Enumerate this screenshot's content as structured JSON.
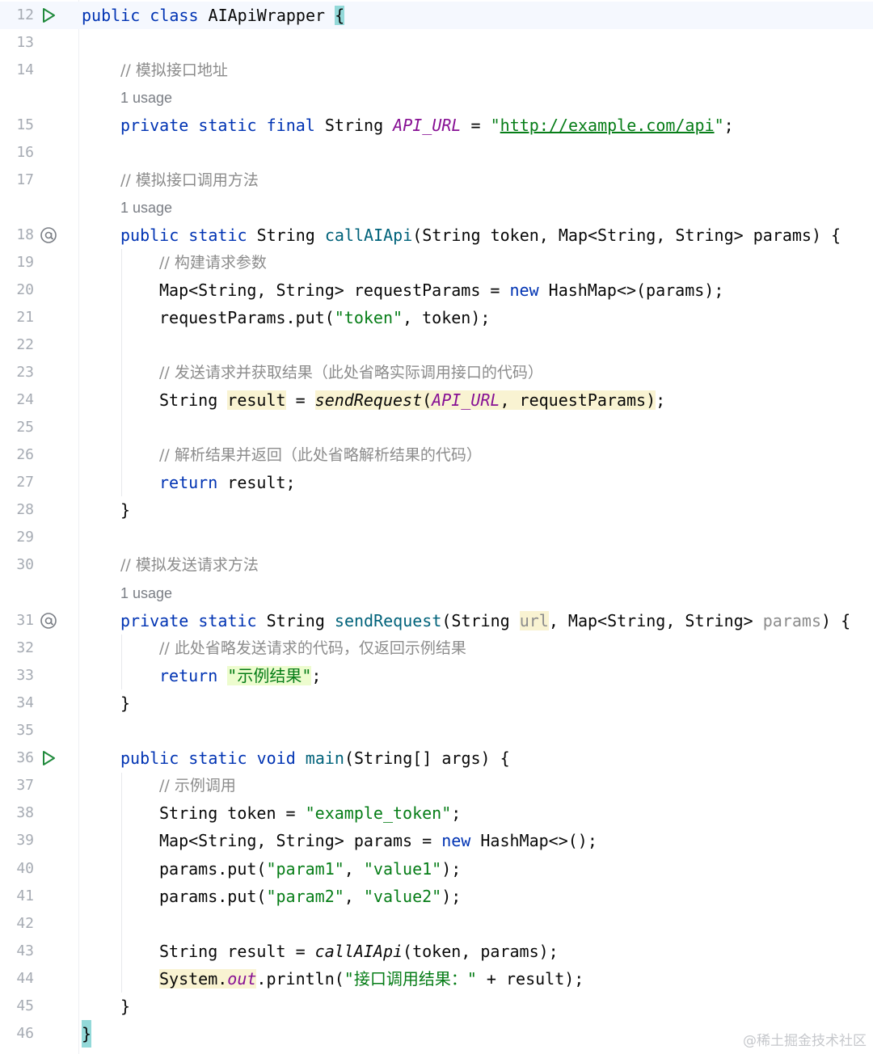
{
  "editor": {
    "line_numbers": [
      "12",
      "13",
      "14",
      "15",
      "16",
      "17",
      "18",
      "19",
      "20",
      "21",
      "22",
      "23",
      "24",
      "25",
      "26",
      "27",
      "28",
      "29",
      "30",
      "31",
      "32",
      "33",
      "34",
      "35",
      "36",
      "37",
      "38",
      "39",
      "40",
      "41",
      "42",
      "43",
      "44",
      "45",
      "46"
    ],
    "usage_hints": [
      "1 usage",
      "1 usage",
      "1 usage"
    ],
    "gutter_icons": {
      "run": "run-triangle-icon",
      "override": "at-sign-icon"
    },
    "colors": {
      "keyword": "#0033b3",
      "string": "#067d17",
      "comment": "#8c8c8c",
      "method": "#00627a",
      "constant": "#871094",
      "line_number": "#a6abb3"
    }
  },
  "code": {
    "l12": {
      "kw": "public class",
      "name": "AIApiWrapper",
      "brace": "{"
    },
    "l14": "// 模拟接口地址",
    "l15": {
      "kw": "private static final",
      "type": "String",
      "const": "API_URL",
      "eq": "=",
      "q1": "\"",
      "url": "http://example.com/api",
      "q2": "\"",
      "semi": ";"
    },
    "l17": "// 模拟接口调用方法",
    "l18": {
      "kw": "public static",
      "type": "String",
      "fn": "callAIApi",
      "args": "(String token, Map<String, String> params) {"
    },
    "l19": "// 构建请求参数",
    "l20": {
      "a": "Map<String, String> requestParams = ",
      "kw": "new",
      "b": " HashMap<>(params);"
    },
    "l21": {
      "a": "requestParams.put(",
      "str": "\"token\"",
      "b": ", token);"
    },
    "l23": "// 发送请求并获取结果（此处省略实际调用接口的代码）",
    "l24": {
      "a": "String ",
      "var": "result",
      "b": " = ",
      "call": "sendRequest",
      "p1": "(",
      "const": "API_URL",
      "c": ", requestParams)",
      "semi": ";"
    },
    "l26": "// 解析结果并返回（此处省略解析结果的代码）",
    "l27": {
      "kw": "return",
      "b": " result;"
    },
    "l28": "}",
    "l30": "// 模拟发送请求方法",
    "l31": {
      "kw": "private static",
      "type": "String",
      "fn": "sendRequest",
      "a": "(String ",
      "p1": "url",
      "b": ", Map<String, String> ",
      "p2": "params",
      "c": ") {"
    },
    "l32": "// 此处省略发送请求的代码，仅返回示例结果",
    "l33": {
      "kw": "return",
      "str": "\"示例结果\"",
      "semi": ";"
    },
    "l34": "}",
    "l36": {
      "kw": "public static void",
      "fn": "main",
      "args": "(String[] args) {"
    },
    "l37": "// 示例调用",
    "l38": {
      "a": "String token = ",
      "str": "\"example_token\"",
      "semi": ";"
    },
    "l39": {
      "a": "Map<String, String> params = ",
      "kw": "new",
      "b": " HashMap<>();"
    },
    "l40": {
      "a": "params.put(",
      "s1": "\"param1\"",
      "b": ", ",
      "s2": "\"value1\"",
      "c": ");"
    },
    "l41": {
      "a": "params.put(",
      "s1": "\"param2\"",
      "b": ", ",
      "s2": "\"value2\"",
      "c": ");"
    },
    "l43": {
      "a": "String result = ",
      "call": "callAIApi",
      "b": "(token, params);"
    },
    "l44": {
      "sys": "System.",
      "out": "out",
      "a": ".println(",
      "str": "\"接口调用结果：\"",
      "b": " + result);"
    },
    "l45": "}",
    "l46": "}"
  },
  "watermark": "@稀土掘金技术社区"
}
